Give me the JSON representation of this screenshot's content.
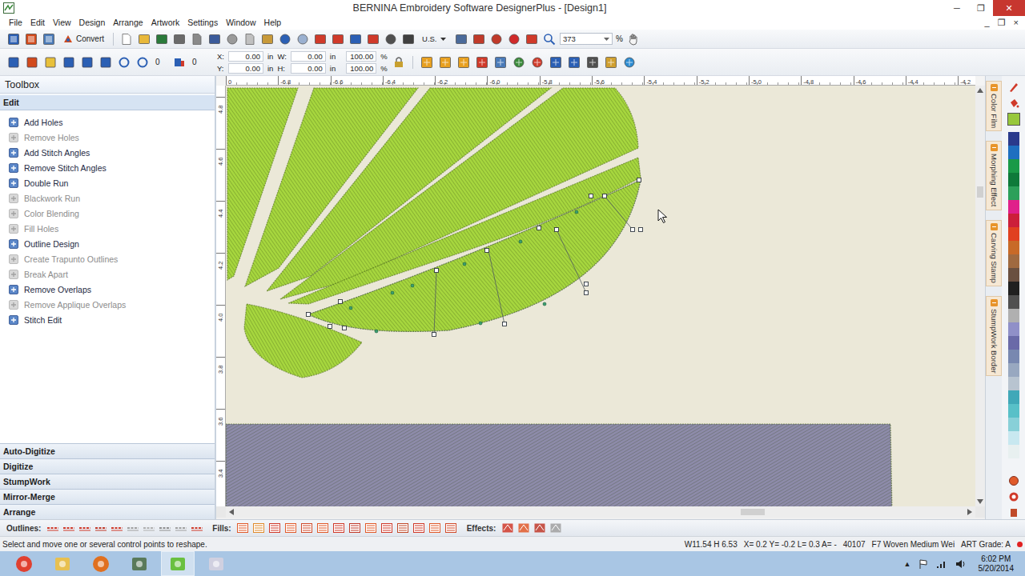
{
  "window": {
    "title": "BERNINA Embroidery Software DesignerPlus - [Design1]",
    "controls": [
      "─",
      "❐",
      "✕"
    ]
  },
  "menu": {
    "items": [
      "File",
      "Edit",
      "View",
      "Design",
      "Arrange",
      "Artwork",
      "Settings",
      "Window",
      "Help"
    ],
    "doc_controls": [
      "_",
      "❐",
      "×"
    ]
  },
  "toolbar": {
    "convert": "Convert",
    "units": "U.S.",
    "zoom": "373",
    "zoom_unit": "%"
  },
  "transform_bar": {
    "rotate": "0",
    "angle": "0",
    "x_label": "X:",
    "x": "0.00",
    "y_label": "Y:",
    "y": "0.00",
    "w_label": "W:",
    "w": "0.00",
    "h_label": "H:",
    "h": "0.00",
    "unit": "in",
    "scale_w": "100.00",
    "scale_h": "100.00",
    "percent": "%"
  },
  "toolbox": {
    "title": "Toolbox",
    "section": "Edit",
    "items": [
      {
        "label": "Add Holes",
        "disabled": false
      },
      {
        "label": "Remove Holes",
        "disabled": true
      },
      {
        "label": "Add Stitch Angles",
        "disabled": false
      },
      {
        "label": "Remove Stitch Angles",
        "disabled": false
      },
      {
        "label": "Double Run",
        "disabled": false
      },
      {
        "label": "Blackwork Run",
        "disabled": true
      },
      {
        "label": "Color Blending",
        "disabled": true
      },
      {
        "label": "Fill Holes",
        "disabled": true
      },
      {
        "label": "Outline Design",
        "disabled": false
      },
      {
        "label": "Create Trapunto Outlines",
        "disabled": true
      },
      {
        "label": "Break Apart",
        "disabled": true
      },
      {
        "label": "Remove Overlaps",
        "disabled": false
      },
      {
        "label": "Remove Applique Overlaps",
        "disabled": true
      },
      {
        "label": "Stitch Edit",
        "disabled": false
      }
    ],
    "sections": [
      "Auto-Digitize",
      "Digitize",
      "StumpWork",
      "Mirror-Merge",
      "Arrange"
    ]
  },
  "rulers": {
    "top": [
      "0",
      "-6.8",
      "-6.6",
      "-6.4",
      "-6.2",
      "-6.0",
      "-5.8",
      "-5.6",
      "-5.4",
      "-5.2",
      "-5.0",
      "-4.8",
      "-4.6",
      "-4.4",
      "-4.2"
    ],
    "left": [
      "4.8",
      "4.6",
      "4.4",
      "4.2",
      "4.0",
      "3.8",
      "3.6",
      "3.4"
    ]
  },
  "canvas": {
    "objects": [
      {
        "kind": "fan",
        "selected": false,
        "color": "#a6d63e"
      },
      {
        "kind": "leaf",
        "selected": false,
        "color": "#a6d63e"
      },
      {
        "kind": "crescent",
        "selected": true,
        "color": "#a6d63e"
      },
      {
        "kind": "band",
        "selected": false,
        "color": "#8d8ba9"
      }
    ]
  },
  "side_tabs": [
    "Color Film",
    "Morphing Effect",
    "Carving Stamp",
    "StumpWork Border"
  ],
  "palette": {
    "current": "#98c83c",
    "colors": [
      "#2a3a8c",
      "#1f6fc0",
      "#1a9a48",
      "#0e7a3a",
      "#2ca05a",
      "#e0208a",
      "#cc1f3a",
      "#e04020",
      "#c86a28",
      "#a06a40",
      "#6a5040",
      "#202020",
      "#505050",
      "#b0b0b0",
      "#9090c8",
      "#6a6aa8",
      "#7888b0",
      "#98a8c0",
      "#b8c4d0",
      "#40a8b8",
      "#58c0c8",
      "#88d0d8",
      "#c8e8f0",
      "#e8f0f0"
    ]
  },
  "bottom_bar": {
    "outlines_label": "Outlines:",
    "fills_label": "Fills:",
    "effects_label": "Effects:"
  },
  "status_bar": {
    "hint": "Select and move one or several control points to reshape.",
    "size": "W11.54 H 6.53",
    "coords": "X= 0.2 Y= -0.2 L= 0.3 A= -",
    "stitches": "40107",
    "fabric": "F7 Woven Medium Wei",
    "grade": "ART Grade: A"
  },
  "taskbar": {
    "tray_arrow": "▲",
    "time": "6:02 PM",
    "date": "5/20/2014"
  }
}
